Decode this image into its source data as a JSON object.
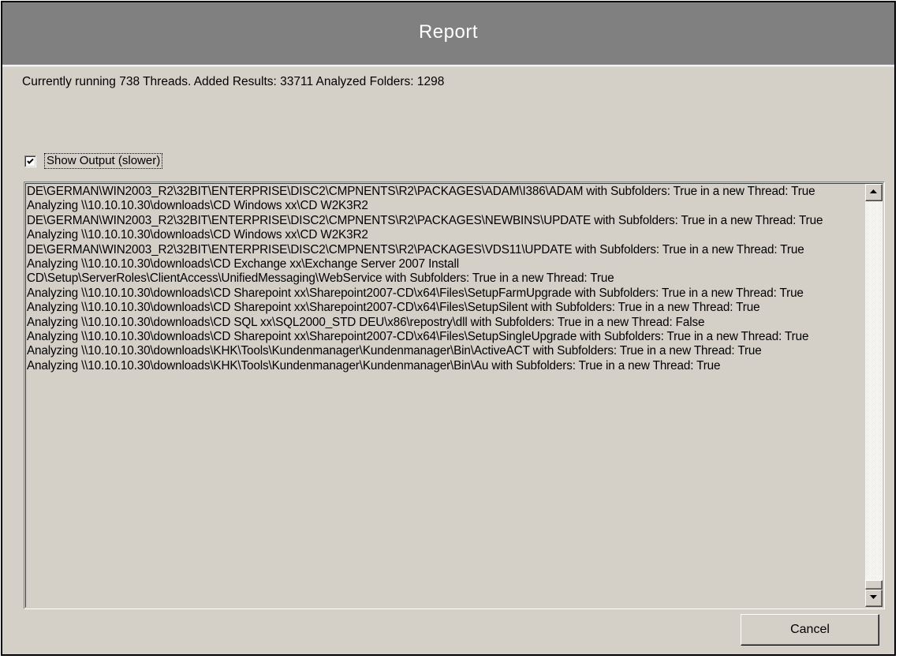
{
  "window": {
    "title": "Report"
  },
  "status": {
    "text": "Currently running 738 Threads. Added Results: 33711 Analyzed Folders: 1298"
  },
  "show_output": {
    "label": "Show Output (slower)",
    "checked": true
  },
  "output": {
    "lines": [
      "DE\\GERMAN\\WIN2003_R2\\32BIT\\ENTERPRISE\\DISC2\\CMPNENTS\\R2\\PACKAGES\\ADAM\\I386\\ADAM with Subfolders: True in a new Thread: True",
      "Analyzing \\\\10.10.10.30\\downloads\\CD Windows xx\\CD W2K3R2",
      "DE\\GERMAN\\WIN2003_R2\\32BIT\\ENTERPRISE\\DISC2\\CMPNENTS\\R2\\PACKAGES\\NEWBINS\\UPDATE with Subfolders: True in a new Thread: True",
      "Analyzing \\\\10.10.10.30\\downloads\\CD Windows xx\\CD W2K3R2",
      "DE\\GERMAN\\WIN2003_R2\\32BIT\\ENTERPRISE\\DISC2\\CMPNENTS\\R2\\PACKAGES\\VDS11\\UPDATE with Subfolders: True in a new Thread: True",
      "Analyzing \\\\10.10.10.30\\downloads\\CD Exchange xx\\Exchange Server 2007 Install",
      "CD\\Setup\\ServerRoles\\ClientAccess\\UnifiedMessaging\\WebService with Subfolders: True in a new Thread: True",
      "Analyzing \\\\10.10.10.30\\downloads\\CD Sharepoint xx\\Sharepoint2007-CD\\x64\\Files\\SetupFarmUpgrade with Subfolders: True in a new Thread: True",
      "Analyzing \\\\10.10.10.30\\downloads\\CD Sharepoint xx\\Sharepoint2007-CD\\x64\\Files\\SetupSilent with Subfolders: True in a new Thread: True",
      "Analyzing \\\\10.10.10.30\\downloads\\CD SQL xx\\SQL2000_STD DEU\\x86\\repostry\\dll with Subfolders: True in a new Thread: False",
      "Analyzing \\\\10.10.10.30\\downloads\\CD Sharepoint xx\\Sharepoint2007-CD\\x64\\Files\\SetupSingleUpgrade with Subfolders: True in a new Thread: True",
      "Analyzing \\\\10.10.10.30\\downloads\\KHK\\Tools\\Kundenmanager\\Kundenmanager\\Bin\\ActiveACT with Subfolders: True in a new Thread: True",
      "Analyzing \\\\10.10.10.30\\downloads\\KHK\\Tools\\Kundenmanager\\Kundenmanager\\Bin\\Au with Subfolders: True in a new Thread: True"
    ]
  },
  "buttons": {
    "cancel_label": "Cancel"
  },
  "colors": {
    "titlebar": "#808080",
    "dialog_bg": "#d4d0c8"
  }
}
